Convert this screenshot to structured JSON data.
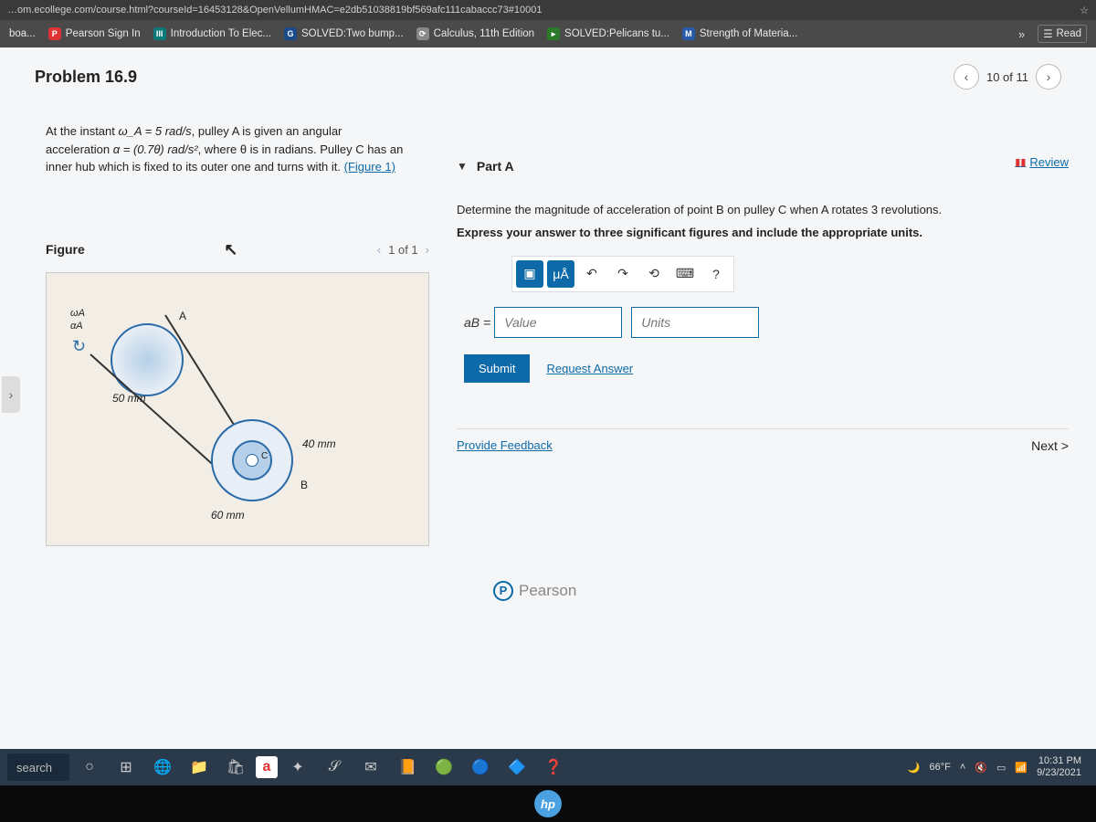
{
  "url": "…om.ecollege.com/course.html?courseId=16453128&OpenVellumHMAC=e2db51038819bf569afc111cabaccc73#10001",
  "bookmarks": {
    "b0": "boa...",
    "b1": "Pearson Sign In",
    "b2": "Introduction To Elec...",
    "b3": "SOLVED:Two bump...",
    "b4": "Calculus, 11th Edition",
    "b5": "SOLVED:Pelicans tu...",
    "b6": "Strength of Materia...",
    "read": "Read"
  },
  "problem": {
    "title": "Problem 16.9",
    "counter": "10 of 11",
    "review": "Review",
    "text1": "At the instant ",
    "omegaA": "ω_A = 5 rad/s",
    "text2": ", pulley A is given an angular acceleration ",
    "alpha": "α = (0.7θ) rad/s²",
    "text3": ", where θ is in radians. Pulley C has an inner hub which is fixed to its outer one and turns with it. ",
    "figLink": "(Figure 1)"
  },
  "figure": {
    "title": "Figure",
    "pager": "1 of 1",
    "r50": "50 mm",
    "r40": "40 mm",
    "r60": "60 mm",
    "A": "A",
    "B": "B",
    "C": "C",
    "wA": "ωA",
    "aA": "αA"
  },
  "partA": {
    "label": "Part A",
    "question": "Determine the magnitude of acceleration of point B on pulley C when A rotates 3 revolutions.",
    "instruction": "Express your answer to three significant figures and include the appropriate units.",
    "equals": "aB =",
    "valuePlaceholder": "Value",
    "unitsPlaceholder": "Units",
    "submit": "Submit",
    "request": "Request Answer",
    "feedback": "Provide Feedback",
    "next": "Next >",
    "muA": "μÅ",
    "help": "?"
  },
  "footer": {
    "pearson": "Pearson"
  },
  "taskbar": {
    "search": "search",
    "temp": "66°F",
    "time": "10:31 PM",
    "date": "9/23/2021"
  }
}
